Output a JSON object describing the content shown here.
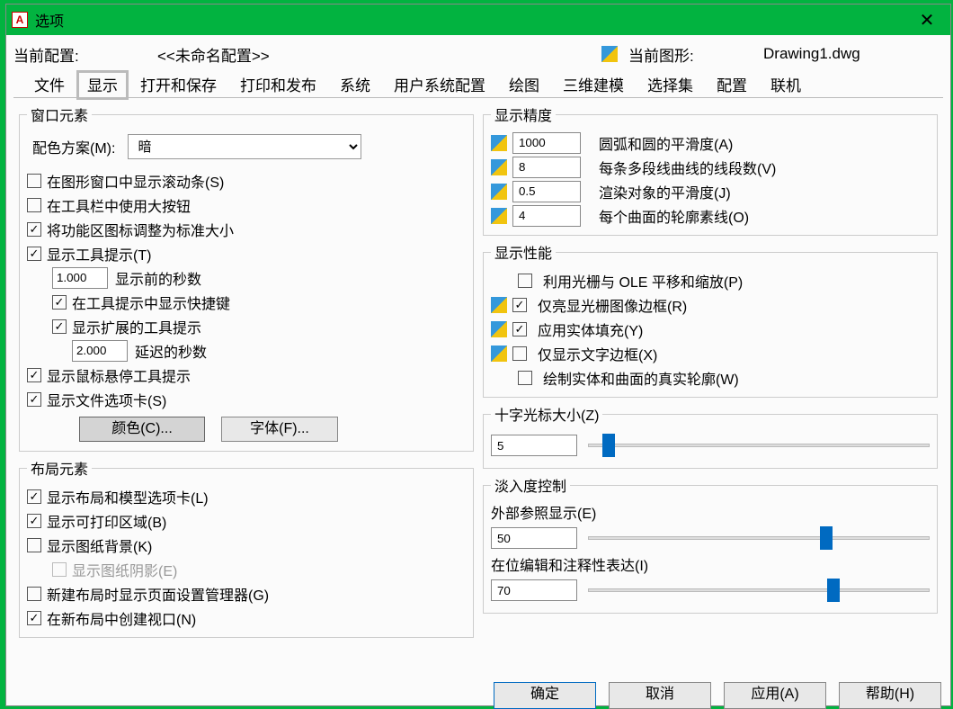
{
  "window": {
    "title": "选项",
    "close": "✕"
  },
  "config": {
    "current_profile_label": "当前配置:",
    "current_profile_value": "<<未命名配置>>",
    "current_drawing_label": "当前图形:",
    "current_drawing_value": "Drawing1.dwg"
  },
  "tabs": [
    "文件",
    "显示",
    "打开和保存",
    "打印和发布",
    "系统",
    "用户系统配置",
    "绘图",
    "三维建模",
    "选择集",
    "配置",
    "联机"
  ],
  "window_elements": {
    "legend": "窗口元素",
    "color_scheme_label": "配色方案(M):",
    "color_scheme_value": "暗",
    "scrollbars": "在图形窗口中显示滚动条(S)",
    "large_buttons": "在工具栏中使用大按钮",
    "resize_ribbon_icons": "将功能区图标调整为标准大小",
    "show_tooltips": "显示工具提示(T)",
    "tooltip_seconds_value": "1.000",
    "tooltip_seconds_label": "显示前的秒数",
    "shortcut_keys": "在工具提示中显示快捷键",
    "extended_tooltips": "显示扩展的工具提示",
    "extended_delay_value": "2.000",
    "extended_delay_label": "延迟的秒数",
    "rollover_tooltips": "显示鼠标悬停工具提示",
    "file_tabs": "显示文件选项卡(S)",
    "colors_btn": "颜色(C)...",
    "fonts_btn": "字体(F)..."
  },
  "layout_elements": {
    "legend": "布局元素",
    "layout_model_tabs": "显示布局和模型选项卡(L)",
    "printable_area": "显示可打印区域(B)",
    "paper_background": "显示图纸背景(K)",
    "paper_shadow": "显示图纸阴影(E)",
    "page_setup_mgr": "新建布局时显示页面设置管理器(G)",
    "create_viewport": "在新布局中创建视口(N)"
  },
  "display_resolution": {
    "legend": "显示精度",
    "arc_smoothness_val": "1000",
    "arc_smoothness": "圆弧和圆的平滑度(A)",
    "polyline_segments_val": "8",
    "polyline_segments": "每条多段线曲线的线段数(V)",
    "render_smoothness_val": "0.5",
    "render_smoothness": "渲染对象的平滑度(J)",
    "contour_lines_val": "4",
    "contour_lines": "每个曲面的轮廓素线(O)"
  },
  "display_performance": {
    "legend": "显示性能",
    "pan_zoom_raster": "利用光栅与 OLE 平移和缩放(P)",
    "highlight_raster_frame": "仅亮显光栅图像边框(R)",
    "apply_solid_fill": "应用实体填充(Y)",
    "text_boundary_only": "仅显示文字边框(X)",
    "draw_true_silhouettes": "绘制实体和曲面的真实轮廓(W)"
  },
  "crosshair": {
    "legend": "十字光标大小(Z)",
    "value": "5"
  },
  "fade_control": {
    "legend": "淡入度控制",
    "xref_label": "外部参照显示(E)",
    "xref_value": "50",
    "inplace_label": "在位编辑和注释性表达(I)",
    "inplace_value": "70"
  },
  "buttons": {
    "ok": "确定",
    "cancel": "取消",
    "apply": "应用(A)",
    "help": "帮助(H)"
  }
}
